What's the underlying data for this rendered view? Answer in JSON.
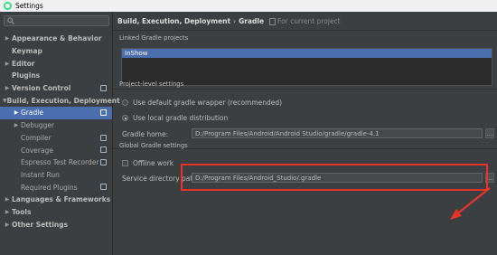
{
  "window": {
    "title": "Settings",
    "colors": {
      "accent": "#4b6eaf",
      "annotation": "#e8332a"
    }
  },
  "search": {
    "placeholder": "",
    "value": ""
  },
  "sidebar": {
    "items": [
      {
        "label": "Appearance & Behavior",
        "arrow": "▶"
      },
      {
        "label": "Keymap"
      },
      {
        "label": "Editor",
        "arrow": "▶"
      },
      {
        "label": "Plugins"
      },
      {
        "label": "Version Control",
        "arrow": "▶"
      },
      {
        "label": "Build, Execution, Deployment",
        "arrow": "▼"
      },
      {
        "label": "Gradle",
        "arrow": "▶"
      },
      {
        "label": "Debugger",
        "arrow": "▶"
      },
      {
        "label": "Compiler"
      },
      {
        "label": "Coverage"
      },
      {
        "label": "Espresso Test Recorder"
      },
      {
        "label": "Instant Run"
      },
      {
        "label": "Required Plugins"
      },
      {
        "label": "Languages & Frameworks",
        "arrow": "▶"
      },
      {
        "label": "Tools",
        "arrow": "▶"
      },
      {
        "label": "Other Settings",
        "arrow": "▶"
      }
    ]
  },
  "breadcrumb": {
    "parent": "Build, Execution, Deployment",
    "separator": "›",
    "current": "Gradle",
    "scope": "For current project"
  },
  "linked_projects": {
    "label": "Linked Gradle projects",
    "items": [
      "InShow"
    ]
  },
  "project_level": {
    "label": "Project-level settings",
    "option_default_wrapper": "Use default gradle wrapper (recommended)",
    "option_local": "Use local gradle distribution",
    "gradle_home_label": "Gradle home:",
    "gradle_home_value": "D:/Program Files/Android/Android Studio/gradle/gradle-4.1",
    "browse_label": "..."
  },
  "global": {
    "label": "Global Gradle settings",
    "offline_work": "Offline work",
    "service_dir_label": "Service directory path:",
    "service_dir_value": "D:/Program Files/Android_Studio/.gradle",
    "browse_label": "..."
  }
}
